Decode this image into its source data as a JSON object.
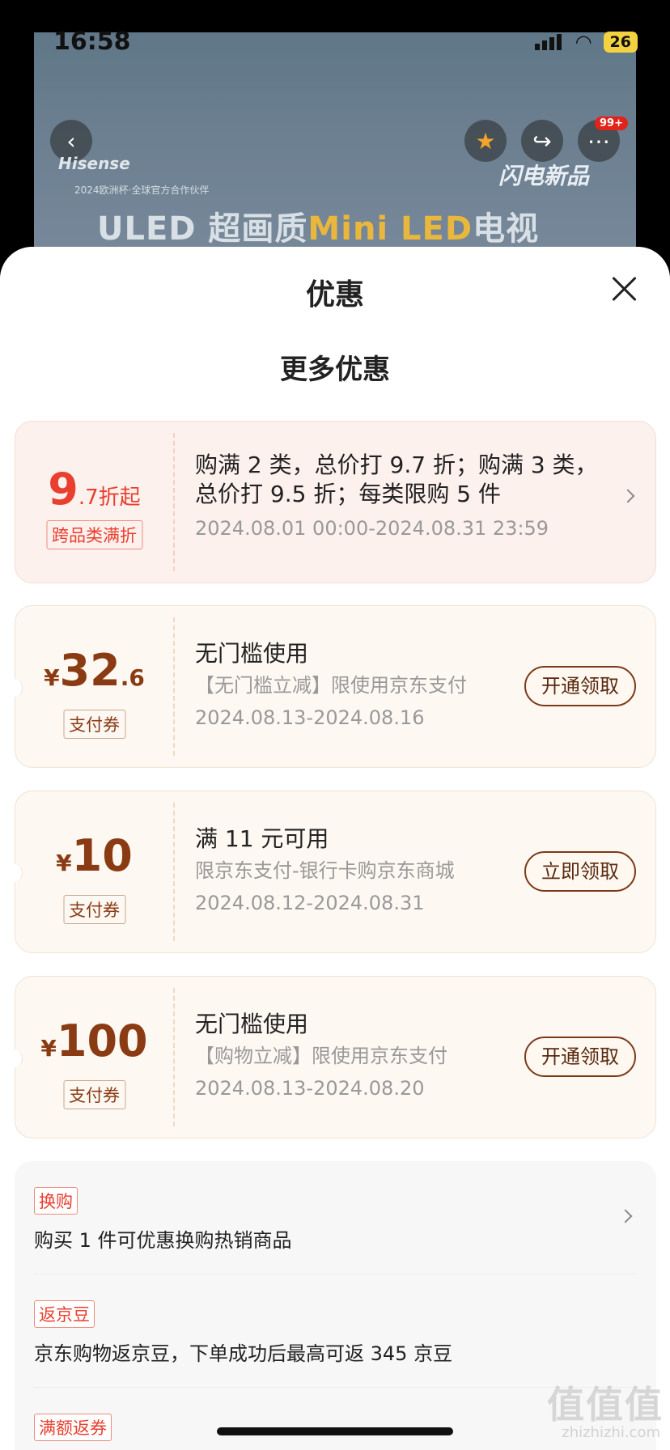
{
  "status": {
    "time": "16:58",
    "battery": "26"
  },
  "background": {
    "badge": "99+",
    "brand_logo": "Hisense",
    "brand_sub": "2024欧洲杯·全球官方合作伙伴",
    "brand_tag": "闪电新品",
    "banner_prefix": "ULED 超画质",
    "banner_highlight": "Mini LED",
    "banner_suffix": "电视"
  },
  "sheet": {
    "title": "优惠",
    "section_title": "更多优惠"
  },
  "cards": [
    {
      "value_big": "9",
      "value_small": ".7折起",
      "tag": "跨品类满折",
      "line1": "购满 2 类，总价打 9.7 折；购满 3 类，总价打 9.5 折；每类限购 5 件",
      "date": "2024.08.01 00:00-2024.08.31 23:59"
    },
    {
      "currency": "¥",
      "value_big": "32",
      "value_small": ".6",
      "tag": "支付券",
      "line1": "无门槛使用",
      "line2": "【无门槛立减】限使用京东支付",
      "date": "2024.08.13-2024.08.16",
      "button": "开通领取"
    },
    {
      "currency": "¥",
      "value_big": "10",
      "tag": "支付券",
      "line1": "满 11 元可用",
      "line2": "限京东支付-银行卡购京东商城",
      "date": "2024.08.12-2024.08.31",
      "button": "立即领取"
    },
    {
      "currency": "¥",
      "value_big": "100",
      "tag": "支付券",
      "line1": "无门槛使用",
      "line2": "【购物立减】限使用京东支付",
      "date": "2024.08.13-2024.08.20",
      "button": "开通领取"
    }
  ],
  "promos": [
    {
      "tag": "换购",
      "text": "购买 1 件可优惠换购热销商品"
    },
    {
      "tag": "返京豆",
      "text": "京东购物返京豆，下单成功后最高可返 345 京豆"
    },
    {
      "tag": "满额返券",
      "text": ""
    }
  ],
  "watermark": {
    "main": "值值值",
    "sub": "zhizhizhi.com"
  }
}
